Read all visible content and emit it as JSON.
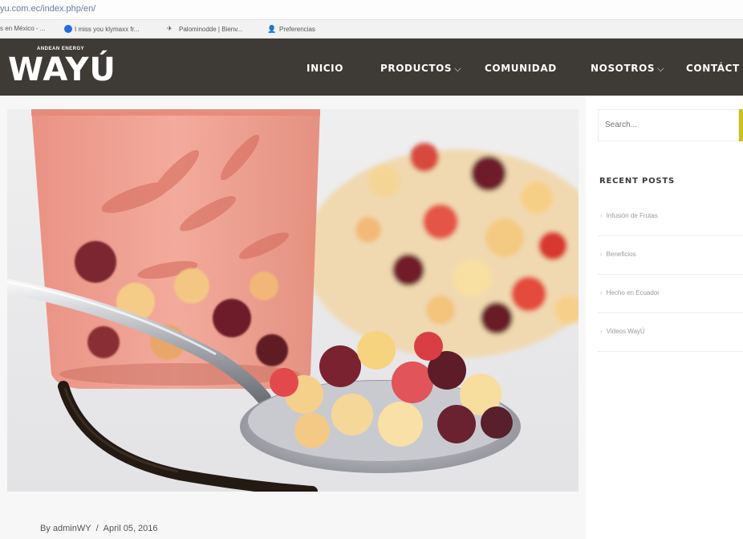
{
  "browser": {
    "url": "yu.com.ec/index.php/en/",
    "bookmarks": [
      {
        "label": "s en México - ..."
      },
      {
        "label": "I miss you klymaxx fr..."
      },
      {
        "label": "Palominodde | Bienv..."
      },
      {
        "label": "Preferencias"
      }
    ]
  },
  "header": {
    "logo_tagline": "ANDEAN ENERGY",
    "logo_text": "WAYÚ",
    "nav": [
      {
        "label": "INICIO",
        "has_dropdown": false
      },
      {
        "label": "PRODUCTOS",
        "has_dropdown": true
      },
      {
        "label": "COMUNIDAD",
        "has_dropdown": false
      },
      {
        "label": "NOSOTROS",
        "has_dropdown": true
      },
      {
        "label": "CONTÁCT",
        "has_dropdown": false
      }
    ],
    "caret": "⌵",
    "background": "#3e3a35"
  },
  "post": {
    "author": "By adminWY",
    "separator": "/",
    "date": "April 05, 2016"
  },
  "sidebar": {
    "search_placeholder": "Search...",
    "accent_color": "#c9c21f",
    "recent_title": "RECENT POSTS",
    "recent_posts": [
      {
        "label": "Infusión de Frutas"
      },
      {
        "label": "Beneficios"
      },
      {
        "label": "Hecho en Ecuador"
      },
      {
        "label": "Videos WayÚ"
      }
    ]
  }
}
